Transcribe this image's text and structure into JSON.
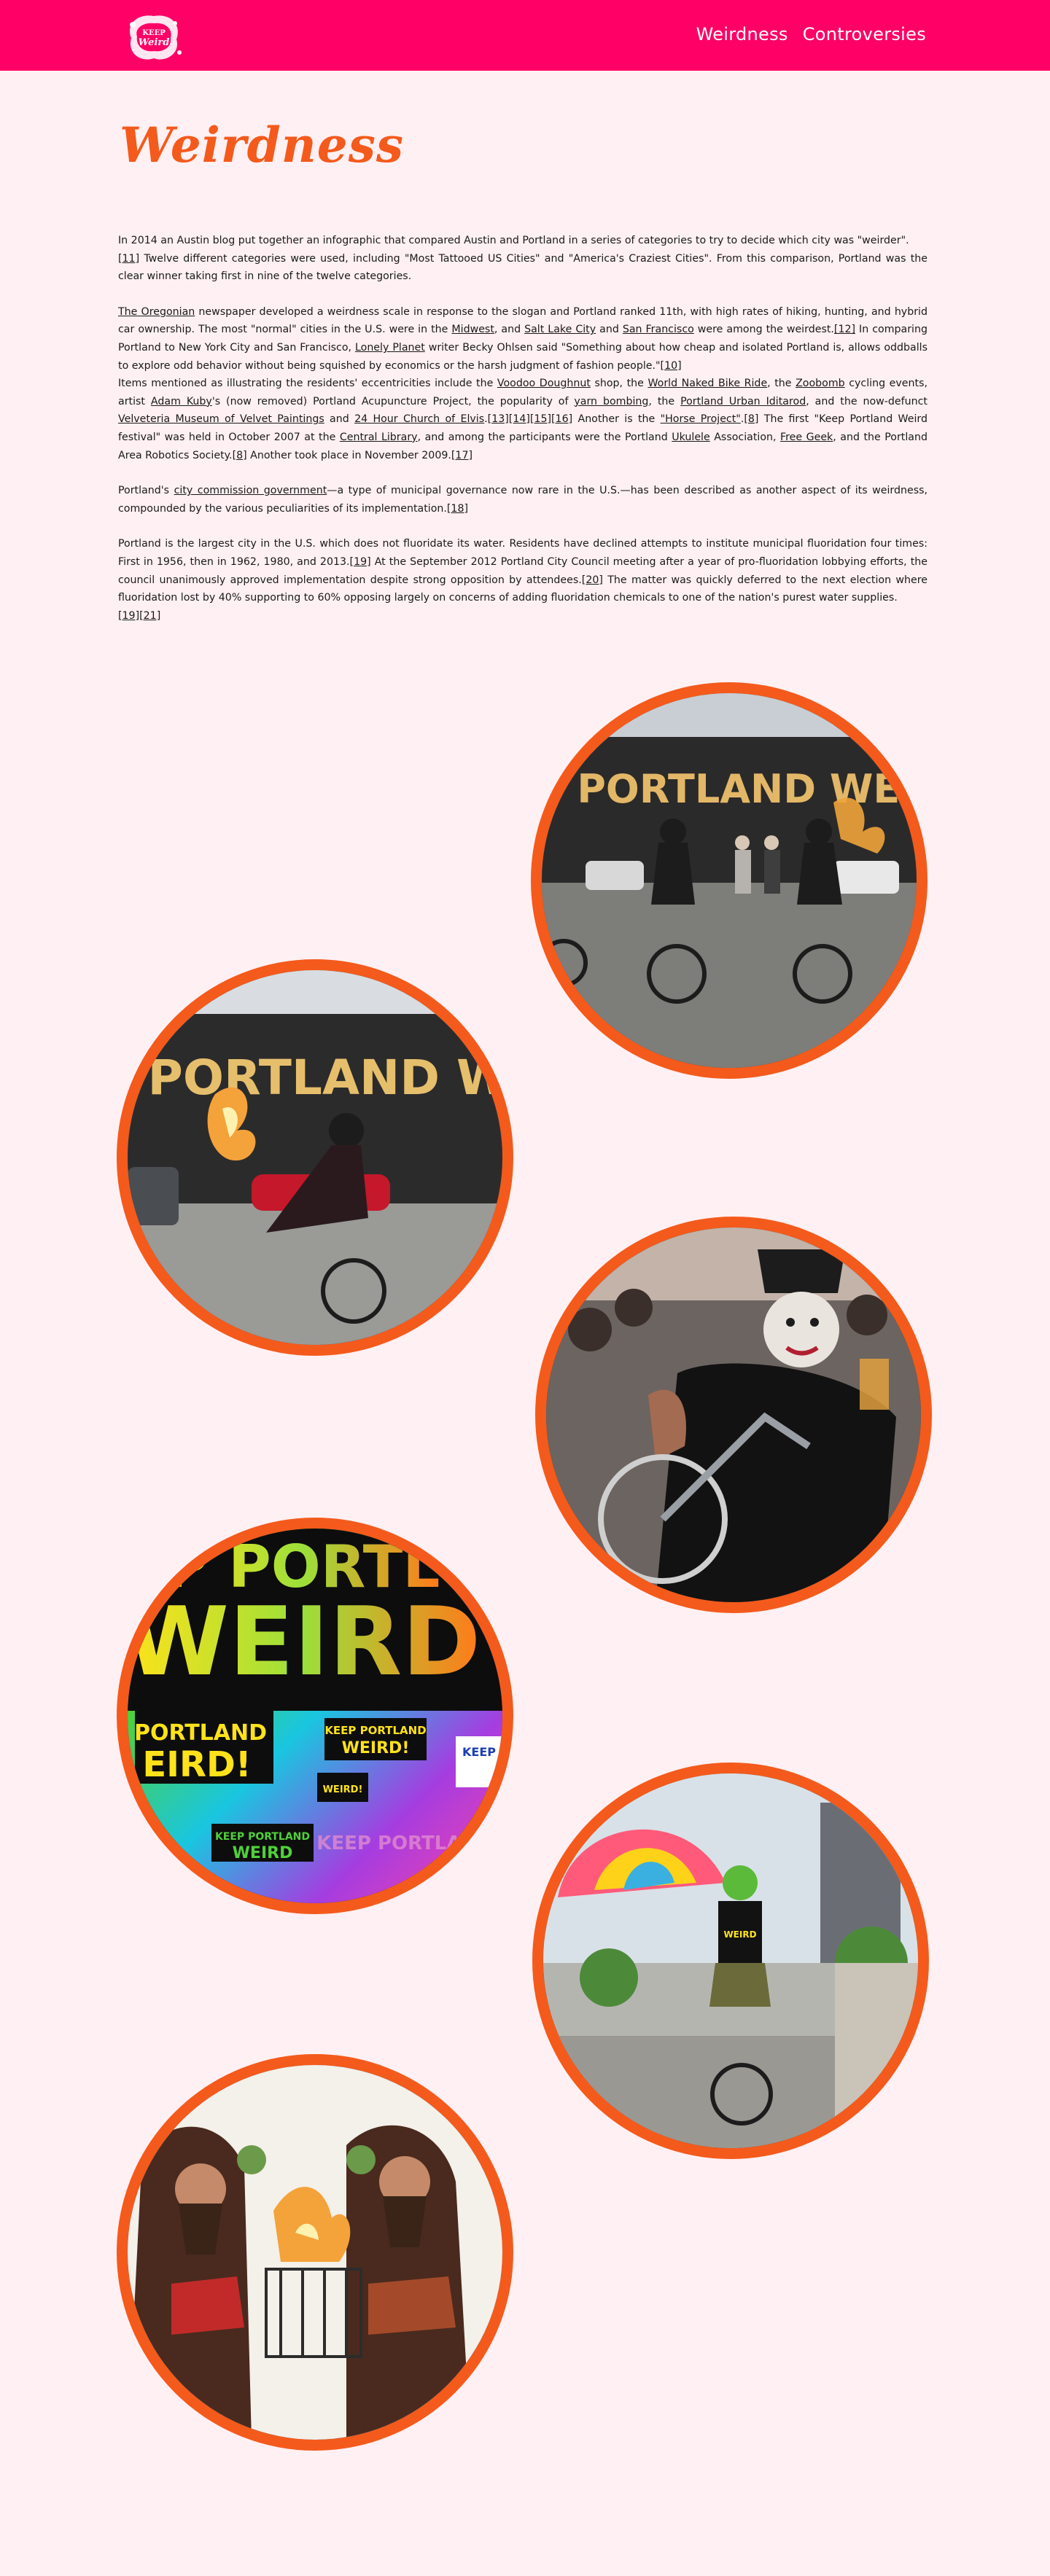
{
  "header": {
    "logo_text": "Keep Portland Weird",
    "nav": [
      {
        "label": "Weirdness"
      },
      {
        "label": "Controversies"
      }
    ]
  },
  "page_title": "Weirdness",
  "paragraphs": {
    "p1": {
      "t1": "In 2014 an Austin blog put together an infographic that compared Austin and Portland in a series of categories to try to decide which city was \"weirder\".",
      "r1": "[11]",
      "t2": " Twelve different categories were used, including \"Most Tattooed US Cities\" and \"America's Craziest Cities\". From this comparison, Portland was the clear winner taking first in nine of the twelve categories."
    },
    "p2": {
      "l1": "The Oregonian",
      "t1": " newspaper developed a weirdness scale in response to the slogan and Portland ranked 11th, with high rates of hiking, hunting, and hybrid car ownership. The most \"normal\" cities in the U.S. were in the ",
      "l2": "Midwest",
      "t2": ", and ",
      "l3": "Salt Lake City",
      "t3": " and ",
      "l4": "San Francisco",
      "t4": " were among the weirdest.",
      "r1": "[12]",
      "t5": " In comparing Portland to New York City and San Francisco, ",
      "l5": "Lonely Planet",
      "t6": " writer Becky Ohlsen said \"Something about how cheap and isolated Portland is, allows oddballs to explore odd behavior without being squished by economics or the harsh judgment of fashion people.\"",
      "r2": "[10]",
      "t7": "Items mentioned as illustrating the residents' eccentricities include the ",
      "l6": "Voodoo Doughnut",
      "t8": " shop, the ",
      "l7": "World Naked Bike Ride",
      "t9": ", the ",
      "l8": "Zoobomb",
      "t10": " cycling events, artist ",
      "l9": "Adam Kuby",
      "t11": "'s (now removed) Portland Acupuncture Project, the popularity of ",
      "l10": "yarn bombing",
      "t12": ", the ",
      "l11": "Portland Urban Iditarod",
      "t13": ", and the now-defunct ",
      "l12": "Velveteria Museum of Velvet Paintings",
      "t14": " and ",
      "l13": "24 Hour Church of Elvis",
      "t15": ".",
      "r3": "[13][14][15][16]",
      "t16": " Another is the ",
      "l14": "\"Horse Project\"",
      "t17": ".",
      "r4": "[8]",
      "t18": " The first \"Keep Portland Weird festival\" was held in October 2007 at the ",
      "l15": "Central Library",
      "t19": ", and among the participants were the Portland ",
      "l16": "Ukulele",
      "t20": " Association, ",
      "l17": "Free Geek",
      "t21": ", and the Portland Area Robotics Society.",
      "r5": "[8]",
      "t22": " Another took place in November 2009.",
      "r6": "[17]"
    },
    "p3": {
      "t1": "Portland's ",
      "l1": "city commission government",
      "t2": "—a type of municipal governance now rare in the U.S.—has been described as another aspect of its weirdness, compounded by the various peculiarities of its implementation.",
      "r1": "[18]"
    },
    "p4": {
      "t1": "Portland is the largest city in the U.S. which does not fluoridate its water. Residents have declined attempts to institute municipal fluoridation four times: First in 1956, then in 1962, 1980, and 2013.",
      "r1": "[19]",
      "t2": " At the September 2012 Portland City Council meeting after a year of pro-fluoridation lobbying efforts, the council unanimously approved implementation despite strong opposition by attendees.",
      "r2": "[20]",
      "t3": " The matter was quickly deferred to the next election where fluoridation lost by 40% supporting to 60% opposing largely on concerns of adding fluoridation chemicals to one of the nation's purest water supplies.",
      "r3": "[19][21]"
    }
  },
  "photos": {
    "photo1_sign": "EEP PORTLAND WEIRD",
    "photo2_sign": "P PORTLAND W",
    "photo4_top": "P PORTL",
    "photo4_big": "WEIRD",
    "photo4_s1a": "PORTLAND",
    "photo4_s1b": "EIRD!",
    "photo4_s2a": "KEEP PORTLAND",
    "photo4_s2b": "WEIRD!",
    "photo4_s3": "WEIRD!",
    "photo4_s4a": "KEEP PORTLAND",
    "photo4_s4b": "WEIRD",
    "photo4_s5": "KEEP PORTLAND",
    "photo4_s6": "KEEP",
    "photo5_shirt": "WEIRD"
  },
  "colors": {
    "header": "#ff0066",
    "accent": "#f45a1c",
    "background": "#fff0f3"
  }
}
